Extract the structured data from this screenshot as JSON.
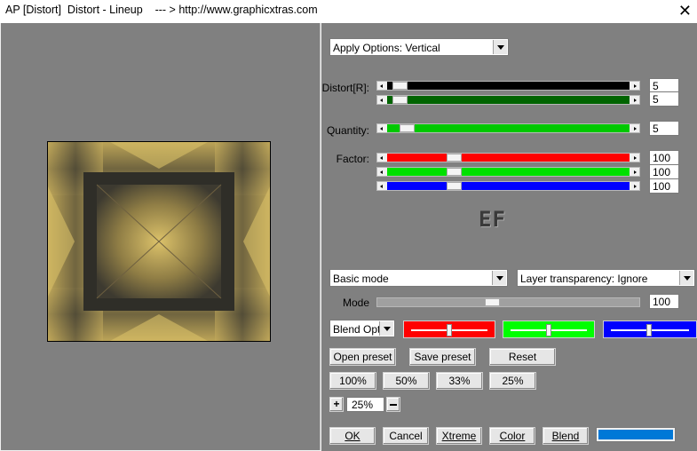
{
  "window": {
    "title": "AP [Distort]  Distort - Lineup    --- > http://www.graphicxtras.com",
    "close_glyph": "✕"
  },
  "apply_options": {
    "value": "Apply Options: Vertical"
  },
  "distort": {
    "label": "Distort[R]:",
    "values": [
      "5",
      "5"
    ],
    "colors": [
      "#000000",
      "#006400"
    ]
  },
  "quantity": {
    "label": "Quantity:",
    "value": "5",
    "color": "#00c800"
  },
  "factor": {
    "label": "Factor:",
    "values": [
      "100",
      "100",
      "100"
    ],
    "colors": [
      "#ff0000",
      "#00e000",
      "#0000ff"
    ]
  },
  "logo_text": "EF",
  "mode_select": {
    "value": "Basic mode"
  },
  "layer_select": {
    "value": "Layer transparency: Ignore"
  },
  "mode": {
    "label": "Mode",
    "value": "100"
  },
  "blend_options": {
    "value": "Blend Optio"
  },
  "presets": {
    "open": "Open preset",
    "save": "Save preset",
    "reset": "Reset"
  },
  "zoom_buttons": [
    "100%",
    "50%",
    "33%",
    "25%"
  ],
  "zoom": {
    "plus": "+",
    "value": "25%"
  },
  "footer": {
    "ok": "OK",
    "cancel": "Cancel",
    "xtreme": "Xtreme",
    "color": "Color",
    "blend": "Blend"
  },
  "colors": {
    "preview_bg": "#808080",
    "blend_color": "#0078d7"
  }
}
